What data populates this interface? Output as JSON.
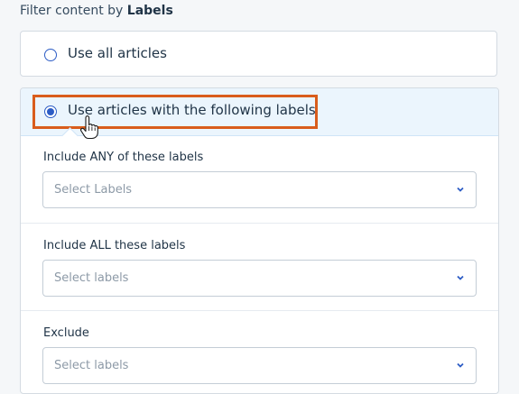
{
  "filter": {
    "title_prefix": "Filter content by ",
    "title_bold": "Labels"
  },
  "options": {
    "all_articles": "Use all articles",
    "following_labels": "Use articles with the following labels"
  },
  "sections": [
    {
      "label": "Include ANY of these labels",
      "placeholder": "Select Labels"
    },
    {
      "label": "Include ALL these labels",
      "placeholder": "Select labels"
    },
    {
      "label": "Exclude",
      "placeholder": "Select labels"
    }
  ],
  "colors": {
    "accent": "#2c5cc5",
    "highlight_box": "#d95d1c",
    "selected_bg": "#ebf5fd"
  },
  "icons": [
    "radio-icon",
    "chevron-down-icon",
    "hand-cursor-icon"
  ]
}
